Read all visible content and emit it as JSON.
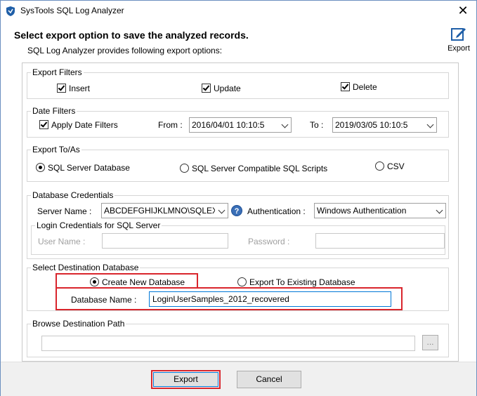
{
  "window": {
    "title": "SysTools SQL Log Analyzer"
  },
  "header": {
    "title": "Select export option to save the analyzed records.",
    "subtitle": "SQL Log Analyzer provides following export options:",
    "export_label": "Export"
  },
  "export_filters": {
    "label": "Export Filters",
    "insert": {
      "label": "Insert",
      "checked": true
    },
    "update": {
      "label": "Update",
      "checked": true
    },
    "delete": {
      "label": "Delete",
      "checked": true
    }
  },
  "date_filters": {
    "label": "Date Filters",
    "apply_label": "Apply Date Filters",
    "apply_checked": true,
    "from_label": "From :",
    "from_value": "2016/04/01 10:10:5",
    "to_label": "To :",
    "to_value": "2019/03/05 10:10:5"
  },
  "export_to": {
    "label": "Export To/As",
    "options": [
      "SQL Server Database",
      "SQL Server Compatible SQL Scripts",
      "CSV"
    ],
    "selected": "SQL Server Database"
  },
  "credentials": {
    "label": "Database Credentials",
    "server_label": "Server Name :",
    "server_value": "ABCDEFGHIJKLMNO\\SQLEX",
    "auth_label": "Authentication :",
    "auth_value": "Windows Authentication",
    "login_group_label": "Login Credentials for SQL Server",
    "user_label": "User Name :",
    "user_value": "",
    "password_label": "Password :",
    "password_value": ""
  },
  "destination": {
    "label": "Select Destination Database",
    "create_label": "Create New Database",
    "existing_label": "Export To Existing Database",
    "selected": "Create New Database",
    "db_name_label": "Database Name :",
    "db_name_value": "LoginUserSamples_2012_recovered"
  },
  "browse": {
    "label": "Browse Destination Path",
    "path_value": "",
    "browse_button": "..."
  },
  "footer": {
    "export_button": "Export",
    "cancel_button": "Cancel"
  },
  "colors": {
    "highlight": "#d9252c",
    "focus": "#0078d7",
    "accent_icon": "#1f5fa8"
  }
}
